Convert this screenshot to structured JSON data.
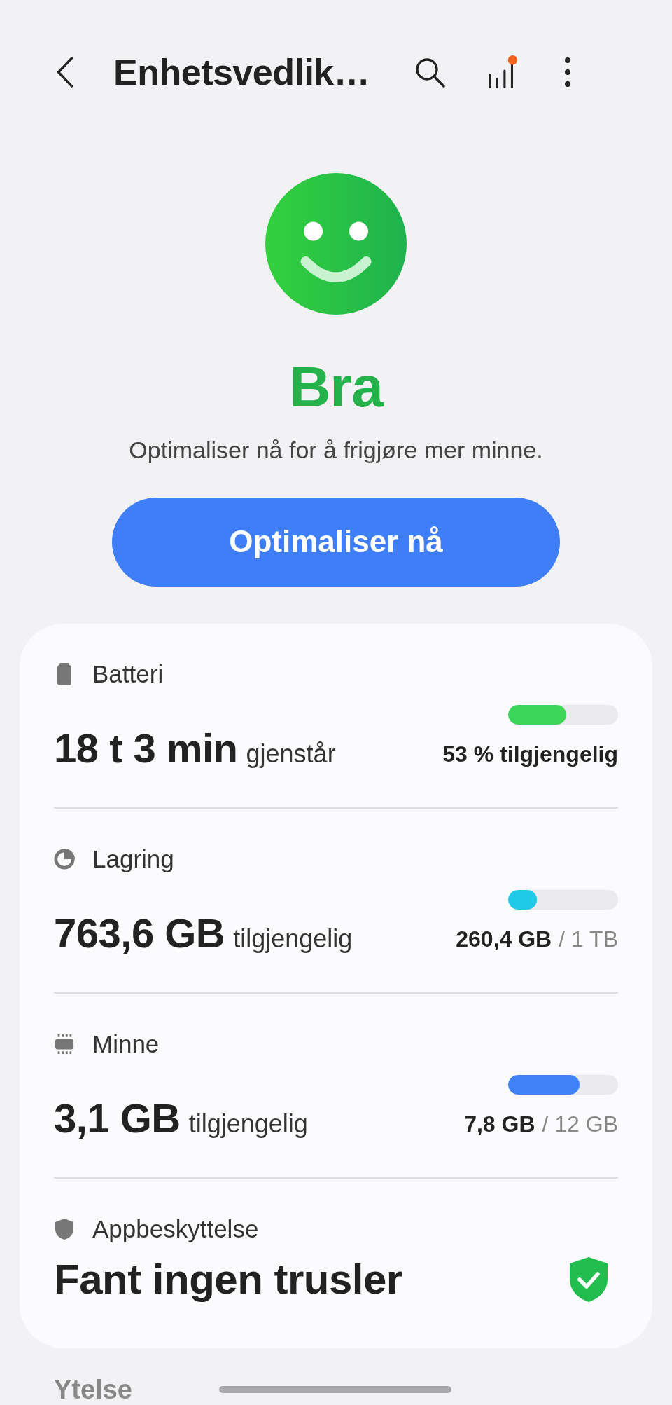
{
  "header": {
    "title": "Enhetsvedlik…"
  },
  "status": {
    "label": "Bra",
    "message": "Optimaliser nå for å frigjøre mer minne."
  },
  "optimize_button": {
    "label": "Optimaliser nå"
  },
  "items": [
    {
      "kind": "meter",
      "label": "Batteri",
      "value": "18 t 3 min",
      "value_suffix": "gjenstår",
      "level": 0.53,
      "color": "#3dd45a",
      "reading": "53 % tilgjengelig"
    },
    {
      "kind": "meter",
      "label": "Lagring",
      "value": "763,6 GB",
      "value_suffix": "tilgjengelig",
      "level": 0.26,
      "color": "#1ec8e6",
      "reading": "260,4 GB",
      "reading_total": "/ 1 TB"
    },
    {
      "kind": "meter",
      "label": "Minne",
      "value": "3,1 GB",
      "value_suffix": "tilgjengelig",
      "level": 0.65,
      "color": "#3f82f7",
      "reading": "7,8 GB",
      "reading_total": "/ 12 GB"
    },
    {
      "kind": "status",
      "label": "Appbeskyttelse",
      "value": "Fant ingen trusler"
    }
  ],
  "section_heading": "Ytelse"
}
